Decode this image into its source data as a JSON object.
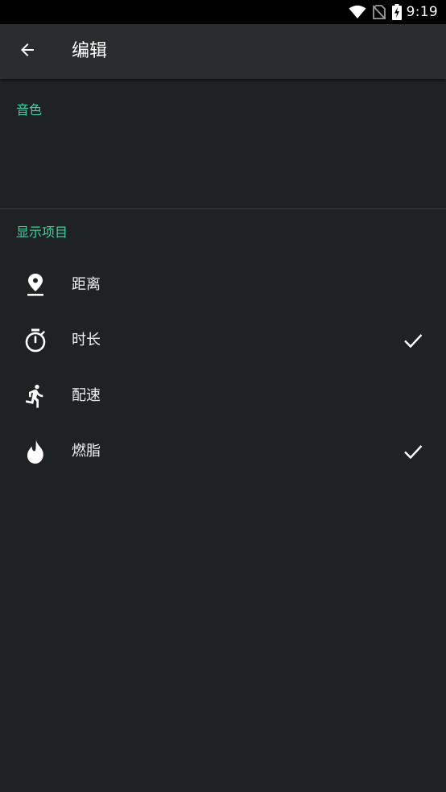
{
  "status_bar": {
    "time": "9:19",
    "icons": [
      "wifi-icon",
      "no-sim-icon",
      "battery-charging-icon"
    ]
  },
  "app_bar": {
    "title": "编辑",
    "back_icon": "arrow-back-icon"
  },
  "sections": {
    "tone": {
      "header": "音色"
    },
    "display_items": {
      "header": "显示项目",
      "items": [
        {
          "label": "距离",
          "icon": "location-pin-icon",
          "checked": false
        },
        {
          "label": "时长",
          "icon": "stopwatch-icon",
          "checked": true
        },
        {
          "label": "配速",
          "icon": "running-icon",
          "checked": false
        },
        {
          "label": "燃脂",
          "icon": "flame-icon",
          "checked": true
        }
      ]
    }
  },
  "colors": {
    "background": "#1f2222",
    "app_bar": "#2a2d2d",
    "accent": "#3ed0a6",
    "text": "#f0f0f0"
  }
}
